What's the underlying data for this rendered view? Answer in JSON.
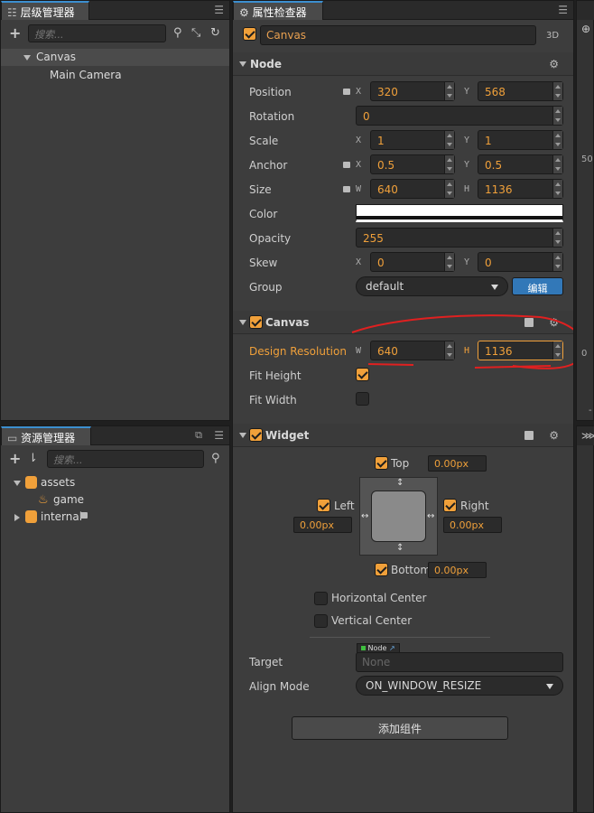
{
  "hierarchy": {
    "tab_label": "层级管理器",
    "search_placeholder": "搜索...",
    "items": [
      {
        "label": "Canvas"
      },
      {
        "label": "Main Camera"
      }
    ]
  },
  "assets": {
    "tab_label": "资源管理器",
    "search_placeholder": "搜索...",
    "items": [
      {
        "label": "assets"
      },
      {
        "label": "game"
      },
      {
        "label": "internal"
      }
    ]
  },
  "inspector": {
    "tab_label": "属性检查器",
    "node_name": "Canvas",
    "mode_badge": "3D",
    "node_section": {
      "title": "Node",
      "position": {
        "label": "Position",
        "x": "320",
        "y": "568"
      },
      "rotation": {
        "label": "Rotation",
        "value": "0"
      },
      "scale": {
        "label": "Scale",
        "x": "1",
        "y": "1"
      },
      "anchor": {
        "label": "Anchor",
        "x": "0.5",
        "y": "0.5"
      },
      "size": {
        "label": "Size",
        "w": "640",
        "h": "1136"
      },
      "color": {
        "label": "Color",
        "value": "#ffffff"
      },
      "opacity": {
        "label": "Opacity",
        "value": "255"
      },
      "skew": {
        "label": "Skew",
        "x": "0",
        "y": "0"
      },
      "group": {
        "label": "Group",
        "value": "default",
        "edit_button": "编辑"
      }
    },
    "canvas_section": {
      "title": "Canvas",
      "design_resolution": {
        "label": "Design Resolution",
        "w": "640",
        "h": "1136"
      },
      "fit_height": {
        "label": "Fit Height",
        "checked": true
      },
      "fit_width": {
        "label": "Fit Width",
        "checked": false
      }
    },
    "widget_section": {
      "title": "Widget",
      "top": {
        "label": "Top",
        "value": "0.00px"
      },
      "left": {
        "label": "Left",
        "value": "0.00px"
      },
      "right": {
        "label": "Right",
        "value": "0.00px"
      },
      "bottom": {
        "label": "Bottom",
        "value": "0.00px"
      },
      "horizontal_center": "Horizontal Center",
      "vertical_center": "Vertical Center",
      "target": {
        "label": "Target",
        "type_badge": "Node",
        "value": "None"
      },
      "align_mode": {
        "label": "Align Mode",
        "value": "ON_WINDOW_RESIZE"
      }
    },
    "add_component": "添加组件"
  },
  "axis_letters": {
    "x": "X",
    "y": "Y",
    "w": "W",
    "h": "H"
  },
  "scene_preview": {
    "ruler_top": "50",
    "ruler_mid": "0",
    "ruler_bottom": "-"
  },
  "colors": {
    "accent": "#f0a03a",
    "highlight_blue": "#3c8fd0",
    "annotation": "#e02020"
  }
}
